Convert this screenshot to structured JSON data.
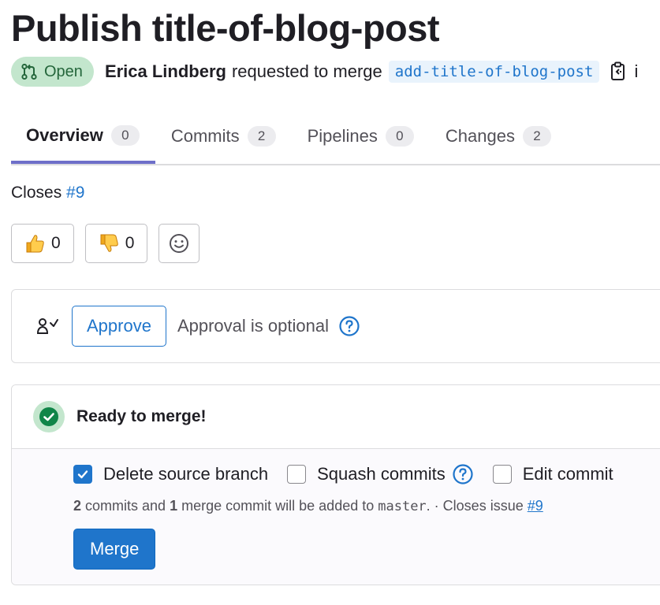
{
  "title": "Publish title-of-blog-post",
  "header": {
    "status": "Open",
    "author": "Erica Lindberg",
    "action_text": "requested to merge",
    "source_branch": "add-title-of-blog-post",
    "trailing_text": "i"
  },
  "tabs": [
    {
      "label": "Overview",
      "count": "0"
    },
    {
      "label": "Commits",
      "count": "2"
    },
    {
      "label": "Pipelines",
      "count": "0"
    },
    {
      "label": "Changes",
      "count": "2"
    }
  ],
  "closes": {
    "prefix": "Closes",
    "issue": "#9"
  },
  "reactions": {
    "thumbs_up": "0",
    "thumbs_down": "0"
  },
  "approval": {
    "button": "Approve",
    "text": "Approval is optional"
  },
  "merge": {
    "status_text": "Ready to merge!",
    "options": {
      "delete_source_branch": "Delete source branch",
      "squash_commits": "Squash commits",
      "edit_commit": "Edit commit"
    },
    "summary": {
      "commit_count": "2",
      "commits_and": "commits and",
      "merge_commit_count": "1",
      "merge_commit_text": "merge commit will be added to",
      "target_branch": "master",
      "closes_text": ". · Closes issue",
      "issue": "#9"
    },
    "merge_button": "Merge"
  },
  "colors": {
    "accent": "#1f75cb",
    "open_badge_bg": "#c3e6cd",
    "open_badge_text": "#24663b",
    "success": "#108548",
    "active_tab_underline": "#6e6fc9"
  }
}
